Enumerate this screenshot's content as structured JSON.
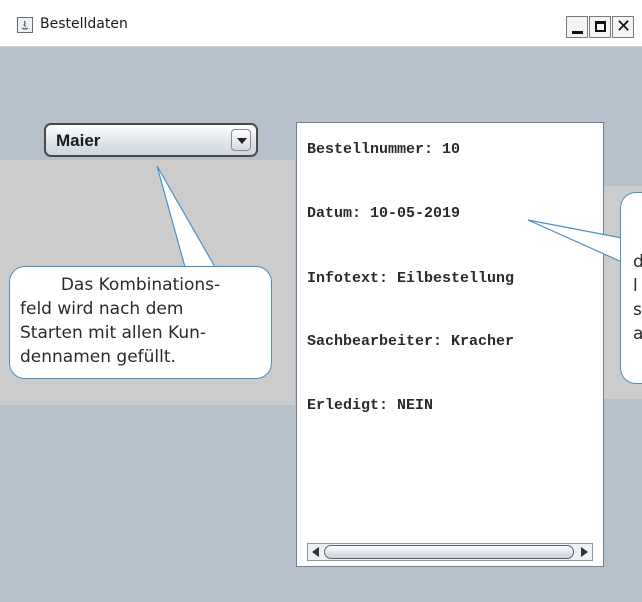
{
  "window": {
    "title": "Bestelldaten",
    "controls": {
      "minimize": "_",
      "maximize": "□",
      "close": "✕"
    }
  },
  "combo": {
    "selected": "Maier"
  },
  "textarea": {
    "lines": [
      "Bestellnummer: 10",
      "Datum: 10-05-2019",
      "Infotext: Eilbestellung",
      "Sachbearbeiter: Kracher",
      "Erledigt: NEIN"
    ]
  },
  "annotations": {
    "left": {
      "lines": [
        "Das Kombinations-",
        "feld wird nach dem",
        "Starten mit allen Kun-",
        "dennamen gefüllt."
      ]
    },
    "right": {
      "lines": [
        "d",
        "l",
        "s",
        "a"
      ]
    }
  },
  "colors": {
    "window_background": "#b6c1cc",
    "annotation_band": "#cccccc",
    "callout_border": "#4a90c8"
  }
}
